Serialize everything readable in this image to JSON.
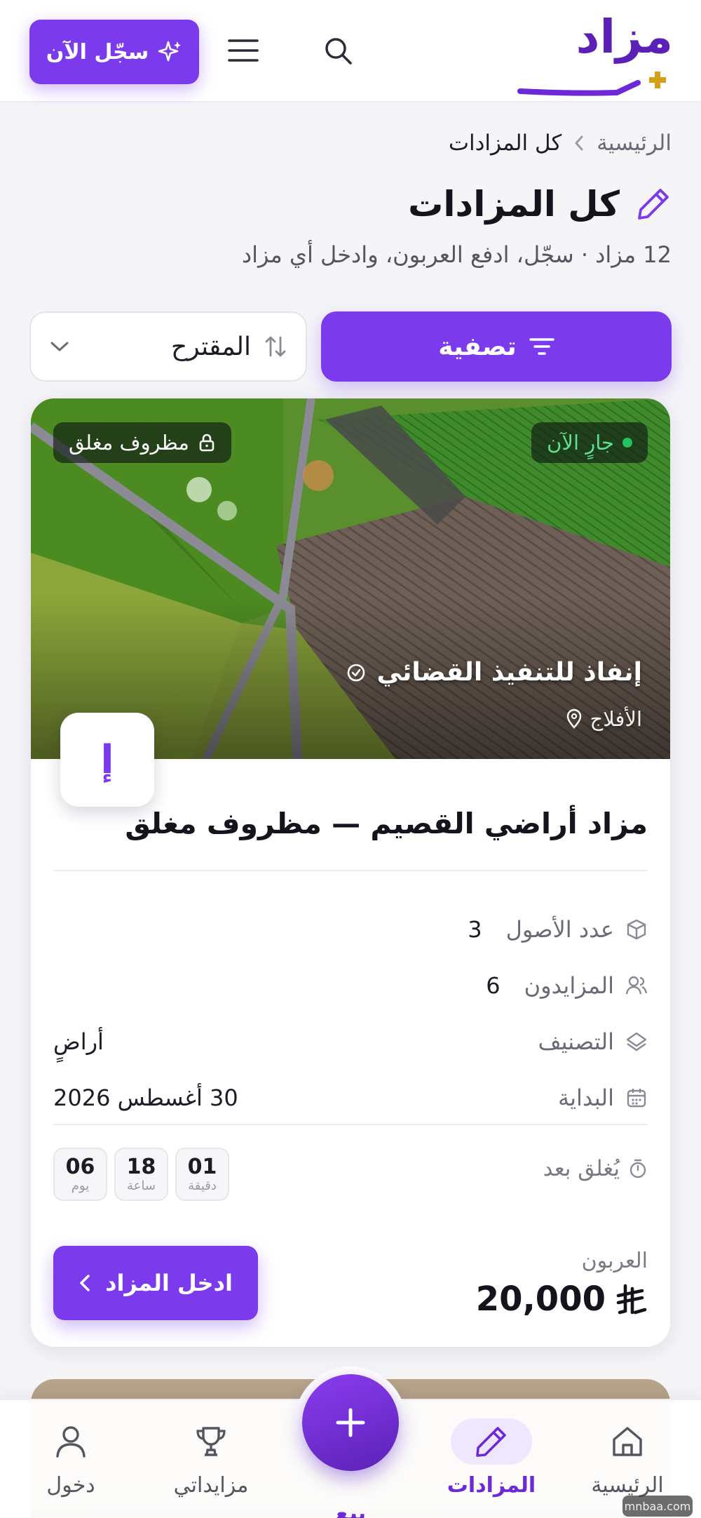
{
  "header": {
    "logo_text": "مزاد",
    "register_label": "سجّل الآن"
  },
  "breadcrumb": {
    "home": "الرئيسية",
    "current": "كل المزادات"
  },
  "page": {
    "title": "كل المزادات",
    "subtitle": "12 مزاد · سجّل، ادفع العربون، وادخل أي مزاد"
  },
  "filters": {
    "filter_label": "تصفية",
    "sort_label": "المقترح"
  },
  "auction_card": {
    "status_badge": "جارٍ الآن",
    "type_badge": "مظروف مغلق",
    "seller_name": "إنفاذ للتنفيذ القضائي",
    "location": "الأفلاج",
    "seller_logo_text": "إ",
    "title": "مزاد أراضي القصيم — مظروف مغلق",
    "assets_label": "عدد الأصول",
    "assets_value": "3",
    "bidders_label": "المزايدون",
    "bidders_value": "6",
    "category_label": "التصنيف",
    "category_value": "أراضٍ",
    "start_label": "البداية",
    "start_value": "30 أغسطس 2026",
    "closes_label": "يُغلق بعد",
    "countdown": {
      "days": "06",
      "days_unit": "يوم",
      "hours": "18",
      "hours_unit": "ساعة",
      "minutes": "01",
      "minutes_unit": "دقيقة"
    },
    "deposit_label": "العربون",
    "deposit_value": "20,000",
    "enter_label": "ادخل المزاد"
  },
  "bottom_nav": {
    "home": "الرئيسية",
    "auctions": "المزادات",
    "sell": "بيع",
    "my_bids": "مزايداتي",
    "login": "دخول"
  },
  "watermark": "mnbaa.com",
  "colors": {
    "accent": "#7c3aed",
    "accent_dark": "#5b21b6",
    "logo_gold": "#d4a017",
    "live_green": "#22c55e"
  },
  "icons": [
    "sparkle-icon",
    "menu-icon",
    "search-icon",
    "chevron-left-icon",
    "pencil-icon",
    "filter-icon",
    "sort-icon",
    "chevron-down-icon",
    "lock-icon",
    "verified-icon",
    "location-pin-icon",
    "cube-icon",
    "users-icon",
    "category-icon",
    "calendar-icon",
    "timer-icon",
    "riyal-icon",
    "home-icon",
    "gavel-icon",
    "plus-icon",
    "trophy-icon",
    "user-icon"
  ]
}
